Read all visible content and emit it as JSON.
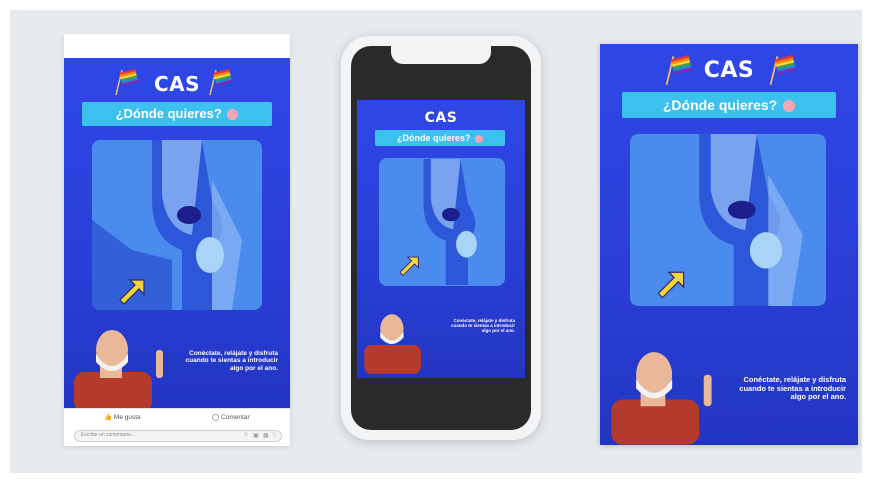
{
  "poster": {
    "brand": "CAS",
    "headline": "¿Dónde quieres?",
    "caption_line1": "Conéctate, relájate y disfruta",
    "caption_line2": "cuando te sientas a introducir",
    "caption_line3": "algo por el ano."
  },
  "facebook": {
    "like_label": "Me gusta",
    "comment_label": "Comentar",
    "comment_placeholder": "Escribe un comentario..."
  },
  "colors": {
    "poster_blue": "#2f47e6",
    "banner_cyan": "#3cc0ee",
    "panel_blue": "#4c8bee",
    "arrow_yellow": "#f5d43a",
    "backdrop": "#e6eaee"
  },
  "icons": [
    "rainbow-flag-icon",
    "peach-emoji-icon",
    "thumbs-up-icon",
    "comment-bubble-icon",
    "arrow-pointer-icon"
  ]
}
